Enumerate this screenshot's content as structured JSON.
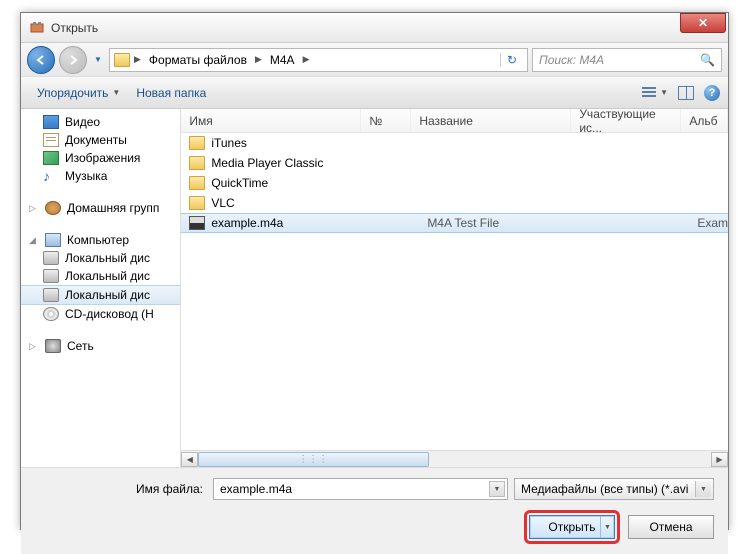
{
  "window": {
    "title": "Открыть"
  },
  "nav": {
    "breadcrumb": [
      "Форматы файлов",
      "M4A"
    ],
    "search_placeholder": "Поиск: M4A"
  },
  "toolbar": {
    "organize": "Упорядочить",
    "new_folder": "Новая папка"
  },
  "sidebar": {
    "libs": [
      {
        "label": "Видео",
        "icon": "video"
      },
      {
        "label": "Документы",
        "icon": "doc"
      },
      {
        "label": "Изображения",
        "icon": "img"
      },
      {
        "label": "Музыка",
        "icon": "music"
      }
    ],
    "homegroup": "Домашняя групп",
    "computer": "Компьютер",
    "drives": [
      {
        "label": "Локальный дис",
        "sel": false
      },
      {
        "label": "Локальный дис",
        "sel": false
      },
      {
        "label": "Локальный дис",
        "sel": true
      },
      {
        "label": "CD-дисковод (H",
        "cd": true
      }
    ],
    "network": "Сеть"
  },
  "columns": {
    "name": "Имя",
    "num": "№",
    "title": "Название",
    "artist": "Участвующие ис...",
    "album": "Альб"
  },
  "files": [
    {
      "name": "iTunes",
      "type": "folder"
    },
    {
      "name": "Media Player Classic",
      "type": "folder"
    },
    {
      "name": "QuickTime",
      "type": "folder"
    },
    {
      "name": "VLC",
      "type": "folder"
    },
    {
      "name": "example.m4a",
      "type": "m4a",
      "title": "M4A Test File",
      "album": "Exam",
      "sel": true
    }
  ],
  "bottom": {
    "file_label": "Имя файла:",
    "file_value": "example.m4a",
    "type_filter": "Медиафайлы (все типы) (*.avi",
    "open": "Открыть",
    "cancel": "Отмена"
  }
}
